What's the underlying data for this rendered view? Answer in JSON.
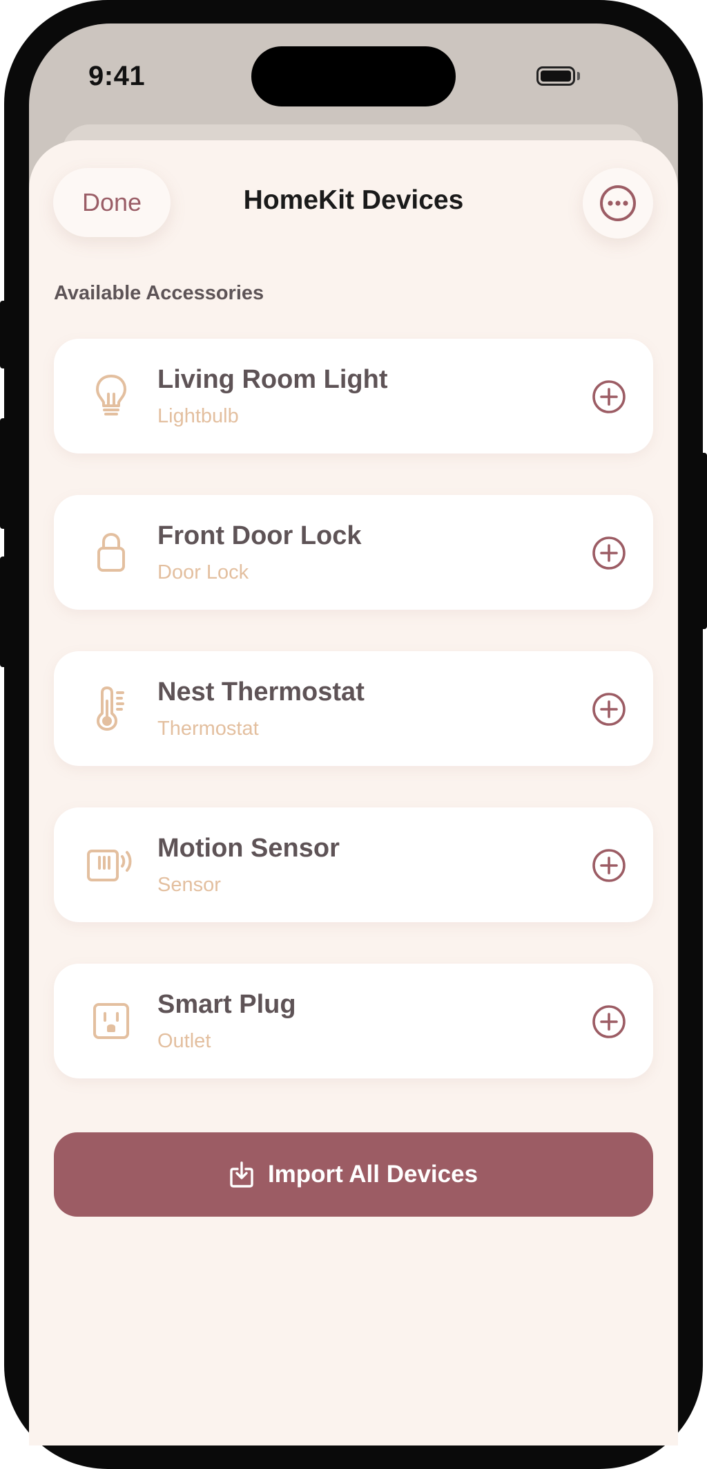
{
  "status_bar": {
    "time": "9:41"
  },
  "header": {
    "done_label": "Done",
    "title": "HomeKit Devices"
  },
  "section": {
    "label": "Available Accessories"
  },
  "devices": [
    {
      "name": "Living Room Light",
      "type": "Lightbulb",
      "icon": "lightbulb-icon"
    },
    {
      "name": "Front Door Lock",
      "type": "Door Lock",
      "icon": "lock-icon"
    },
    {
      "name": "Nest Thermostat",
      "type": "Thermostat",
      "icon": "thermometer-icon"
    },
    {
      "name": "Motion Sensor",
      "type": "Sensor",
      "icon": "motion-sensor-icon"
    },
    {
      "name": "Smart Plug",
      "type": "Outlet",
      "icon": "outlet-icon"
    }
  ],
  "import_button": {
    "label": "Import All Devices",
    "icon": "import-icon"
  },
  "colors": {
    "accent": "#9c5c64",
    "sheet_background": "#fbf3ee",
    "icon_tint": "#e3bf9f",
    "text_primary": "#5e5356"
  }
}
